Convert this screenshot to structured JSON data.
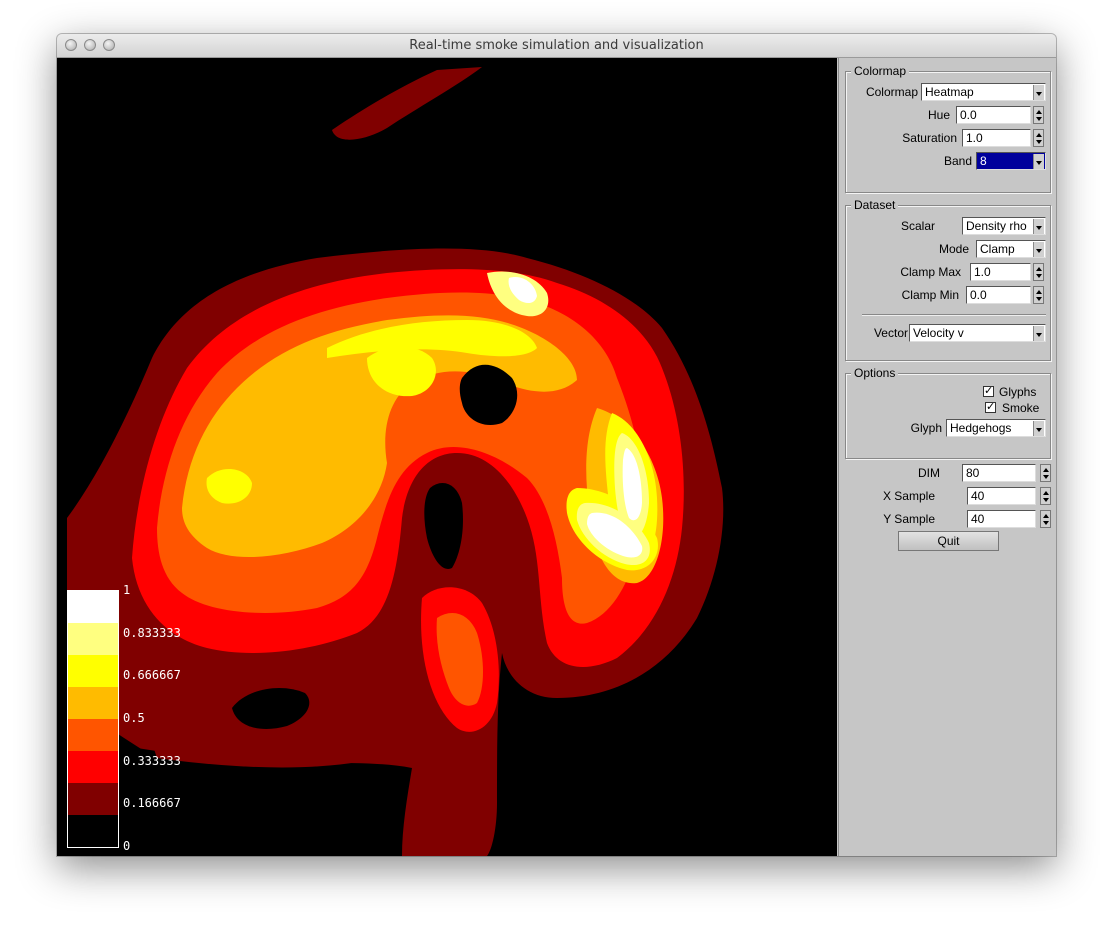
{
  "window": {
    "title": "Real-time smoke simulation and visualization"
  },
  "colormap_group": {
    "title": "Colormap",
    "colormap_label": "Colormap",
    "colormap_value": "Heatmap",
    "hue_label": "Hue",
    "hue_value": "0.0",
    "saturation_label": "Saturation",
    "saturation_value": "1.0",
    "band_label": "Band",
    "band_value": "8"
  },
  "dataset_group": {
    "title": "Dataset",
    "scalar_label": "Scalar",
    "scalar_value": "Density rho",
    "mode_label": "Mode",
    "mode_value": "Clamp",
    "clamp_max_label": "Clamp Max",
    "clamp_max_value": "1.0",
    "clamp_min_label": "Clamp Min",
    "clamp_min_value": "0.0",
    "vector_label": "Vector",
    "vector_value": "Velocity v"
  },
  "options_group": {
    "title": "Options",
    "glyphs_label": "Glyphs",
    "glyphs_checked": true,
    "smoke_label": "Smoke",
    "smoke_checked": true,
    "glyph_label": "Glyph",
    "glyph_value": "Hedgehogs"
  },
  "sim": {
    "dim_label": "DIM",
    "dim_value": "80",
    "xsample_label": "X Sample",
    "xsample_value": "40",
    "ysample_label": "Y Sample",
    "ysample_value": "40",
    "quit_label": "Quit"
  },
  "legend": {
    "labels": [
      "1",
      "0.833333",
      "0.666667",
      "0.5",
      "0.333333",
      "0.166667",
      "0"
    ],
    "band_colors": [
      "#ffffff",
      "#ffff80",
      "#ffff00",
      "#ffbb00",
      "#ff5500",
      "#ff0000",
      "#800000",
      "#000000"
    ]
  },
  "colors": {
    "background": "#000000",
    "band1": "#800000",
    "band2": "#ff0000",
    "band3": "#ff5500",
    "band4": "#ffbb00",
    "band5": "#ffff00",
    "band6": "#ffff80",
    "band7": "#ffffff",
    "selection": "#00009c"
  }
}
